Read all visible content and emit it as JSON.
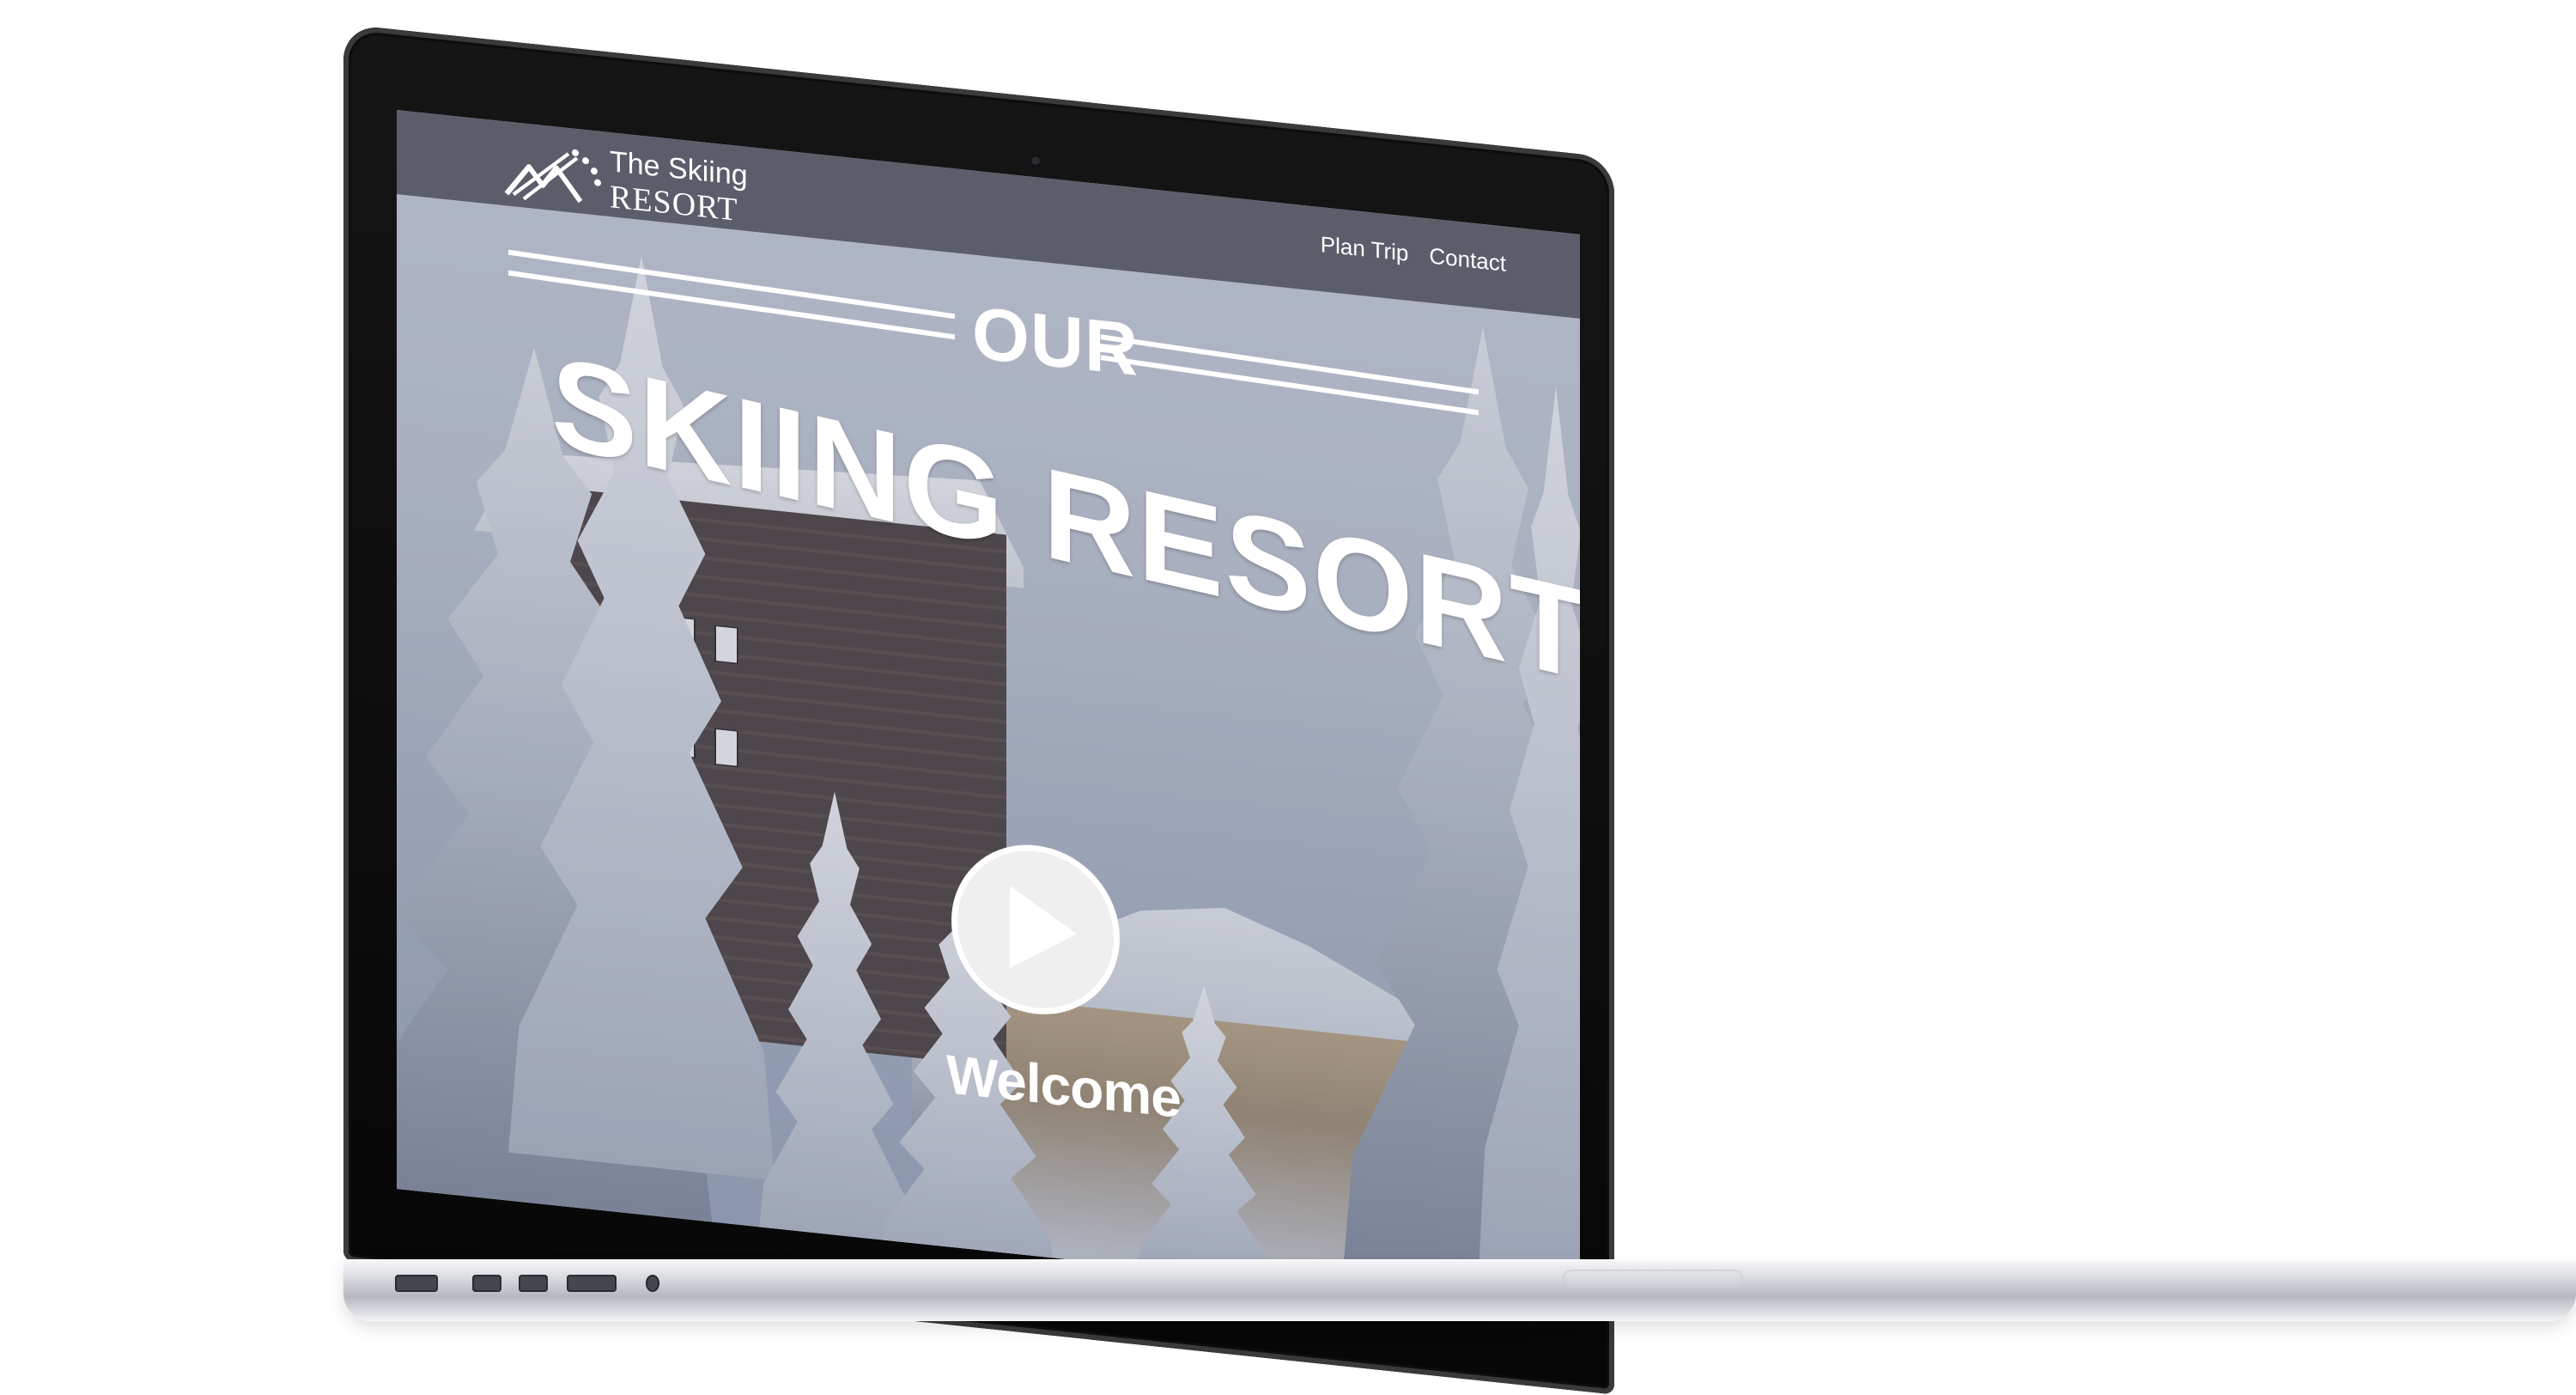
{
  "site": {
    "brand_line1": "The Skiing",
    "brand_line2": "RESORT",
    "nav_items": [
      "Plan Trip",
      "Contact"
    ]
  },
  "hero": {
    "subtitle": "OUR",
    "title": "SKIING RESORT",
    "cta_label": "Welcome"
  },
  "icons": {
    "logo": "ski-mountain-logo",
    "play": "play-icon"
  },
  "colors": {
    "header_overlay": "#3a3c46",
    "text": "#ffffff"
  }
}
